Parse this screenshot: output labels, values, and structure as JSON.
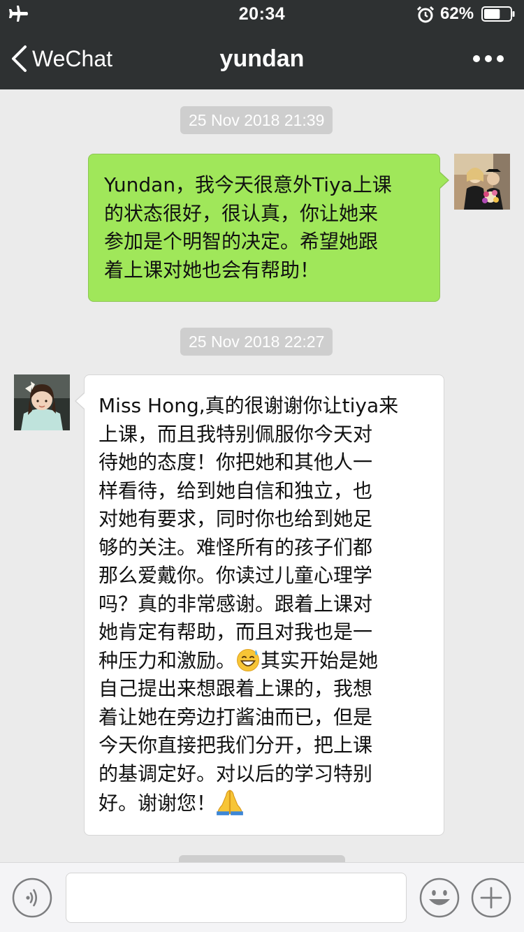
{
  "status_bar": {
    "time": "20:34",
    "battery_percent": "62%",
    "battery_level": 0.62
  },
  "nav": {
    "back_label": "WeChat",
    "title": "yundan"
  },
  "messages": [
    {
      "timestamp": "25 Nov 2018 21:39",
      "sender": "me",
      "lines": [
        "Yundan，我今天很意外Tiya上课",
        "的状态很好，很认真，你让她来",
        "参加是个明智的决定。希望她跟",
        "着上课对她也会有帮助！"
      ]
    },
    {
      "timestamp": "25 Nov 2018 22:27",
      "sender": "them",
      "lines": [
        "Miss Hong,真的很谢谢你让tiya来",
        "上课，而且我特别佩服你今天对",
        "待她的态度！你把她和其他人一",
        "样看待，给到她自信和独立，也",
        "对她有要求，同时你也给到她足",
        "够的关注。难怪所有的孩子们都",
        "那么爱戴你。你读过儿童心理学",
        "吗？真的非常感谢。跟着上课对",
        "她肯定有帮助，而且对我也是一",
        "种压力和激励。",
        "其实开始是她",
        "自己提出来想跟着上课的，我想",
        "着让她在旁边打酱油而已，但是",
        "今天你直接把我们分开，把上课",
        "的基调定好。对以后的学习特别",
        "好。谢谢您！"
      ],
      "emojis": [
        "grinning-sweat-emoji",
        "folded-hands-emoji"
      ]
    }
  ],
  "input": {
    "value": "",
    "placeholder": ""
  },
  "colors": {
    "nav_bg": "#2e3132",
    "chat_bg": "#ebebeb",
    "my_bubble": "#a0e75a",
    "their_bubble": "#ffffff",
    "timestamp_bg": "#cecece"
  }
}
